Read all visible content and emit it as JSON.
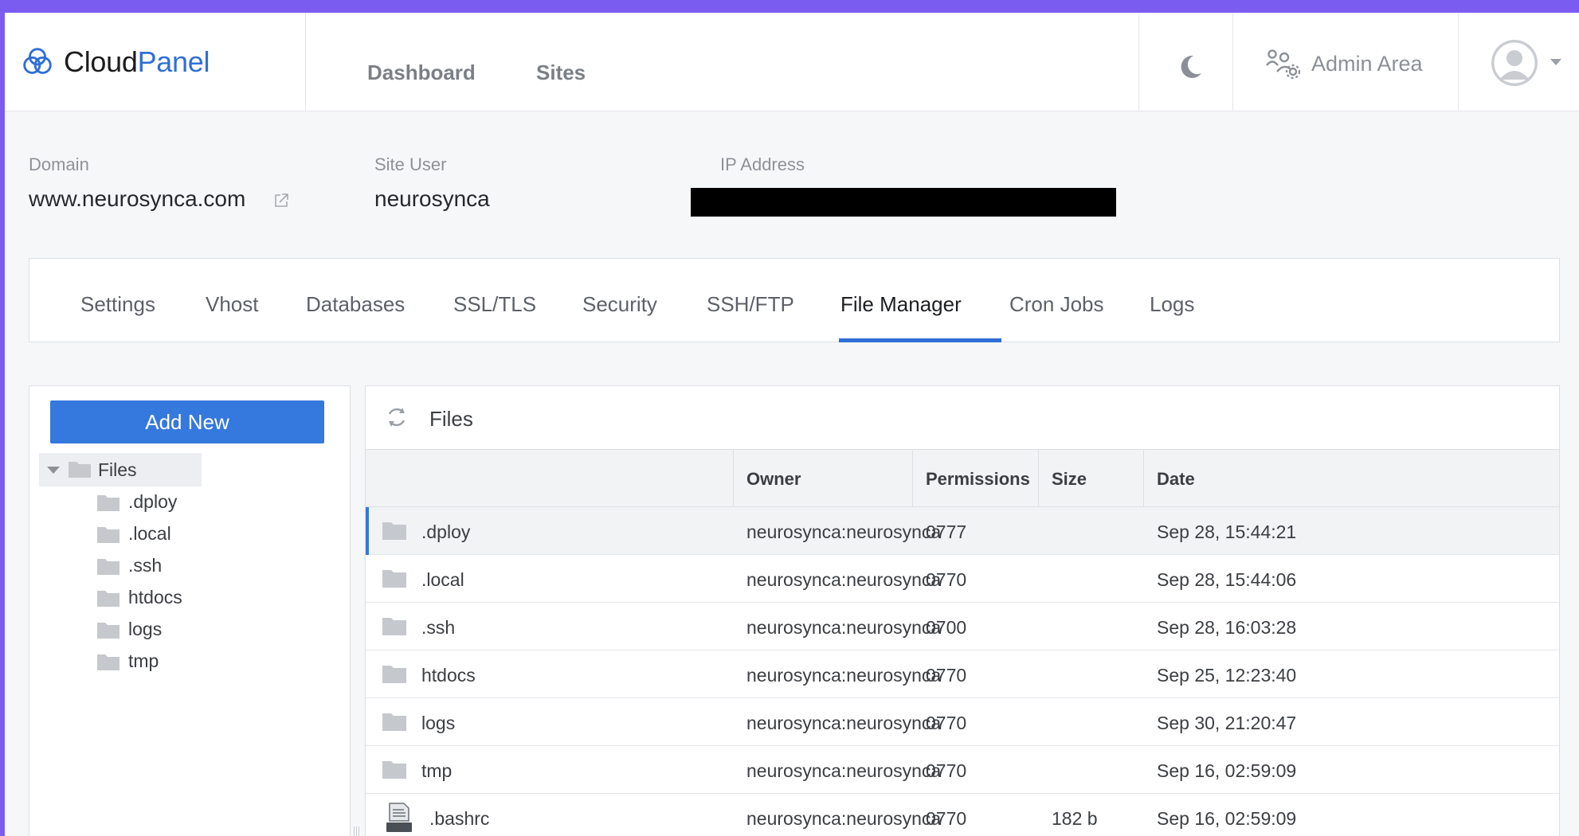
{
  "app": {
    "logo_part1": "Cloud",
    "logo_part2": "Panel",
    "accent_color": "#2f6fd6",
    "top_border_color": "#7b5cf0"
  },
  "header": {
    "nav": [
      "Dashboard",
      "Sites"
    ],
    "theme_toggle_icon": "moon-icon",
    "admin_label": "Admin Area",
    "admin_icon": "users-gear-icon",
    "avatar_icon": "user-avatar-icon"
  },
  "site": {
    "domain_label": "Domain",
    "domain_value": "www.neurosynca.com",
    "user_label": "Site User",
    "user_value": "neurosynca",
    "ip_label": "IP Address",
    "ip_value": ""
  },
  "tabs": [
    {
      "label": "Settings"
    },
    {
      "label": "Vhost"
    },
    {
      "label": "Databases"
    },
    {
      "label": "SSL/TLS"
    },
    {
      "label": "Security"
    },
    {
      "label": "SSH/FTP"
    },
    {
      "label": "File Manager",
      "active": true
    },
    {
      "label": "Cron Jobs"
    },
    {
      "label": "Logs"
    }
  ],
  "sidebar": {
    "add_new_label": "Add New",
    "root_label": "Files",
    "children": [
      ".dploy",
      ".local",
      ".ssh",
      "htdocs",
      "logs",
      "tmp"
    ]
  },
  "files": {
    "title": "Files",
    "columns": [
      "",
      "Owner",
      "Permissions",
      "Size",
      "Date"
    ],
    "rows": [
      {
        "type": "folder",
        "name": ".dploy",
        "owner": "neurosynca:neurosynca",
        "permissions": "0777",
        "size": "",
        "date": "Sep 28, 15:44:21",
        "selected": true
      },
      {
        "type": "folder",
        "name": ".local",
        "owner": "neurosynca:neurosynca",
        "permissions": "0770",
        "size": "",
        "date": "Sep 28, 15:44:06"
      },
      {
        "type": "folder",
        "name": ".ssh",
        "owner": "neurosynca:neurosynca",
        "permissions": "0700",
        "size": "",
        "date": "Sep 28, 16:03:28"
      },
      {
        "type": "folder",
        "name": "htdocs",
        "owner": "neurosynca:neurosynca",
        "permissions": "0770",
        "size": "",
        "date": "Sep 25, 12:23:40"
      },
      {
        "type": "folder",
        "name": "logs",
        "owner": "neurosynca:neurosynca",
        "permissions": "0770",
        "size": "",
        "date": "Sep 30, 21:20:47"
      },
      {
        "type": "folder",
        "name": "tmp",
        "owner": "neurosynca:neurosynca",
        "permissions": "0770",
        "size": "",
        "date": "Sep 16, 02:59:09"
      },
      {
        "type": "file",
        "name": ".bashrc",
        "owner": "neurosynca:neurosynca",
        "permissions": "0770",
        "size": "182 b",
        "date": "Sep 16, 02:59:09"
      }
    ]
  }
}
